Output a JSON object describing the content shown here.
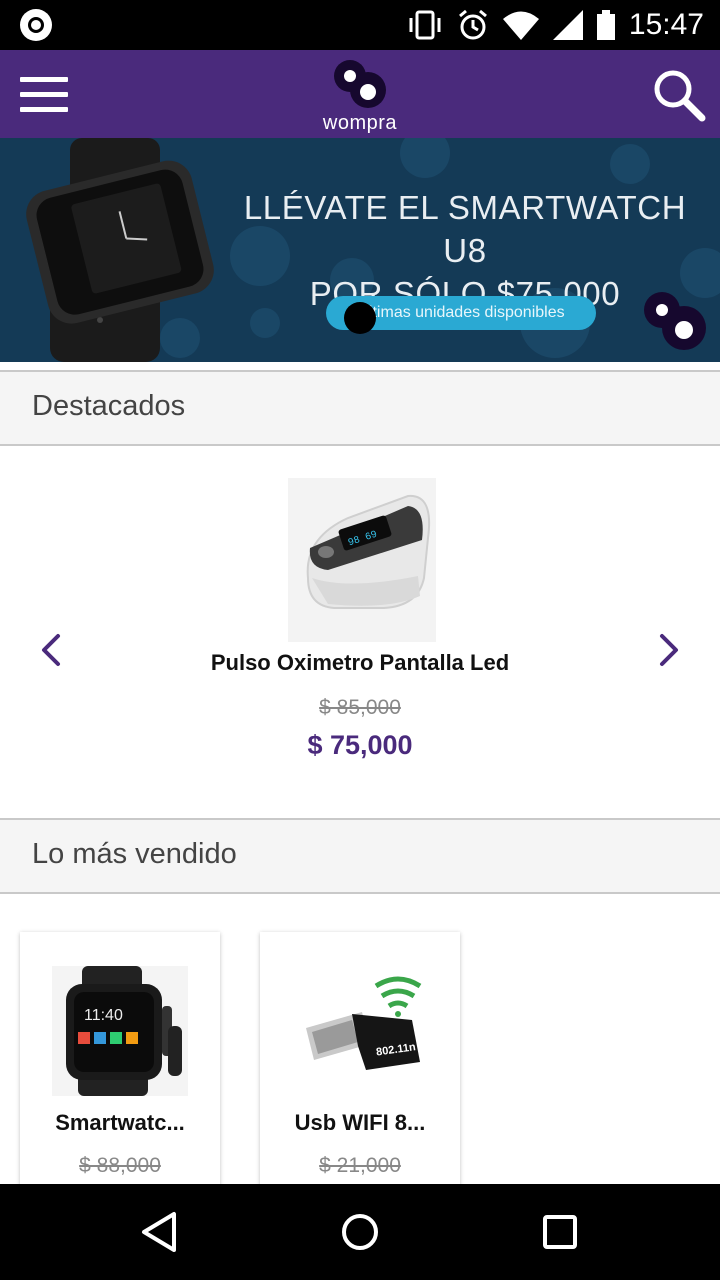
{
  "status_bar": {
    "time": "15:47",
    "icons": [
      "app-notification-icon",
      "vibrate-icon",
      "alarm-icon",
      "wifi-icon",
      "signal-icon",
      "battery-icon"
    ]
  },
  "app_bar": {
    "logo_text": "wompra",
    "background": "#4a2a7c",
    "menu_icon": "hamburger-menu-icon",
    "search_icon": "search-icon"
  },
  "banner": {
    "headline_line1": "LLÉVATE EL SMARTWATCH U8",
    "headline_line2": "POR SÓLO $75.000",
    "pill_text": "Últimas unidades disponibles"
  },
  "featured": {
    "section_title": "Destacados",
    "product": {
      "name": "Pulso Oximetro Pantalla Led",
      "old_price": "$ 85,000",
      "price": "$ 75,000"
    },
    "prev_icon": "chevron-left-icon",
    "next_icon": "chevron-right-icon"
  },
  "best_sellers": {
    "section_title": "Lo más vendido",
    "products": [
      {
        "name": "Smartwatc...",
        "old_price": "$ 88,000"
      },
      {
        "name": "Usb WIFI 8...",
        "old_price": "$ 21,000"
      }
    ]
  },
  "nav_bar": {
    "back_icon": "back-triangle-icon",
    "home_icon": "home-circle-icon",
    "recents_icon": "recents-square-icon"
  },
  "colors": {
    "brand": "#4a2a7c",
    "banner_bg": "#143a56",
    "pill": "#2aa9d3"
  }
}
